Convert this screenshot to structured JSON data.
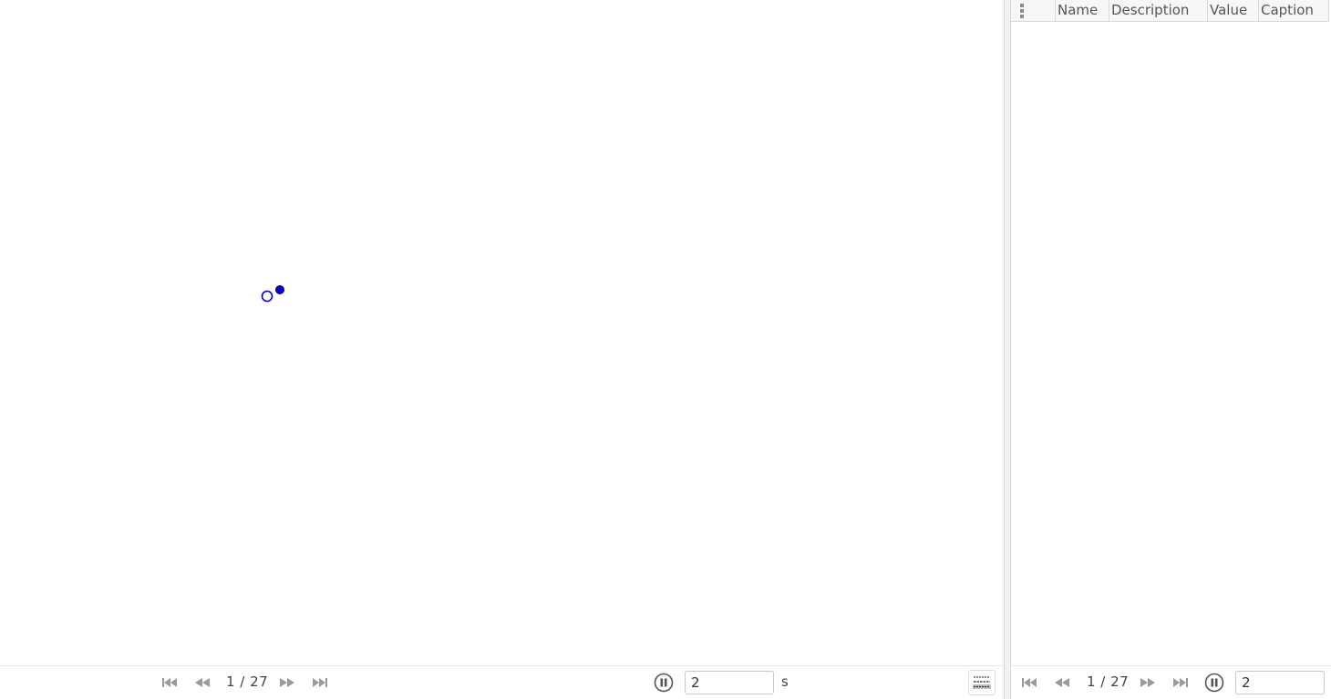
{
  "graphics": {
    "navigation": {
      "counter": "1 / 27",
      "speed_value": "2",
      "speed_unit": "s"
    },
    "points": [
      {
        "style": "hollow",
        "color": "#0000cc"
      },
      {
        "style": "filled",
        "color": "#0000cc"
      }
    ]
  },
  "table": {
    "columns": [
      "Name",
      "Description",
      "Value",
      "Caption"
    ],
    "rows": [],
    "navigation": {
      "counter": "1 / 27",
      "speed_value": "2"
    }
  },
  "colors": {
    "point": "#0000cc",
    "nav_icon": "#9a9a9a",
    "play_icon": "#555555"
  },
  "icons": {
    "first": "skip-to-first-icon",
    "prev": "step-back-icon",
    "next": "step-forward-icon",
    "last": "skip-to-last-icon",
    "pause": "pause-icon",
    "algebra": "algebra-view-icon",
    "menu": "kebab-menu-icon"
  }
}
